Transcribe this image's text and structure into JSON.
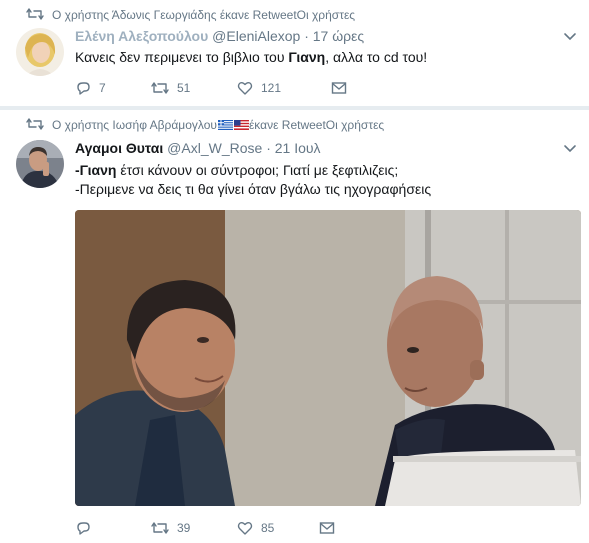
{
  "tweets": [
    {
      "context_user": "Ο χρήστης Άδωνις Γεωργιάδης έκανε Retweet",
      "context_suffix": "Οι χρήστες",
      "fullname": "Ελένη Αλεξοπούλου",
      "screen_name": "@EleniAlexop",
      "dot": "·",
      "time": "17 ώρες",
      "text_before": "Κανεις δεν περιμενει το βιβλιο του ",
      "text_bold": "Γιανη",
      "text_after": ", αλλα το cd του!",
      "reply_count": "7",
      "retweet_count": "51",
      "like_count": "121"
    },
    {
      "context_user": "Ο χρήστης Ιωσήφ Αβράμογλου",
      "context_suffix": " έκανε RetweetΟι χρήστες",
      "fullname": "Αγαμοι Θυται",
      "screen_name": "@Axl_W_Rose",
      "dot": "·",
      "time": "21 Ιουλ",
      "line1_bold": "-Γιανη",
      "line1_rest": " έτσι κάνουν οι σύντροφοι; Γιατί με ξεφτιλιζεις;",
      "line2": "-Περιμενε να δεις τι θα γίνει όταν βγάλω τις ηχογραφήσεις",
      "reply_count": "",
      "retweet_count": "39",
      "like_count": "85"
    }
  ],
  "icons": {
    "retweet_context": "retweet-icon",
    "caret": "chevron-down-icon",
    "reply": "reply-icon",
    "retweet": "retweet-icon",
    "like": "heart-icon",
    "dm": "envelope-icon"
  },
  "colors": {
    "text": "#14171a",
    "secondary": "#657786",
    "background": "#e6ecf0"
  }
}
